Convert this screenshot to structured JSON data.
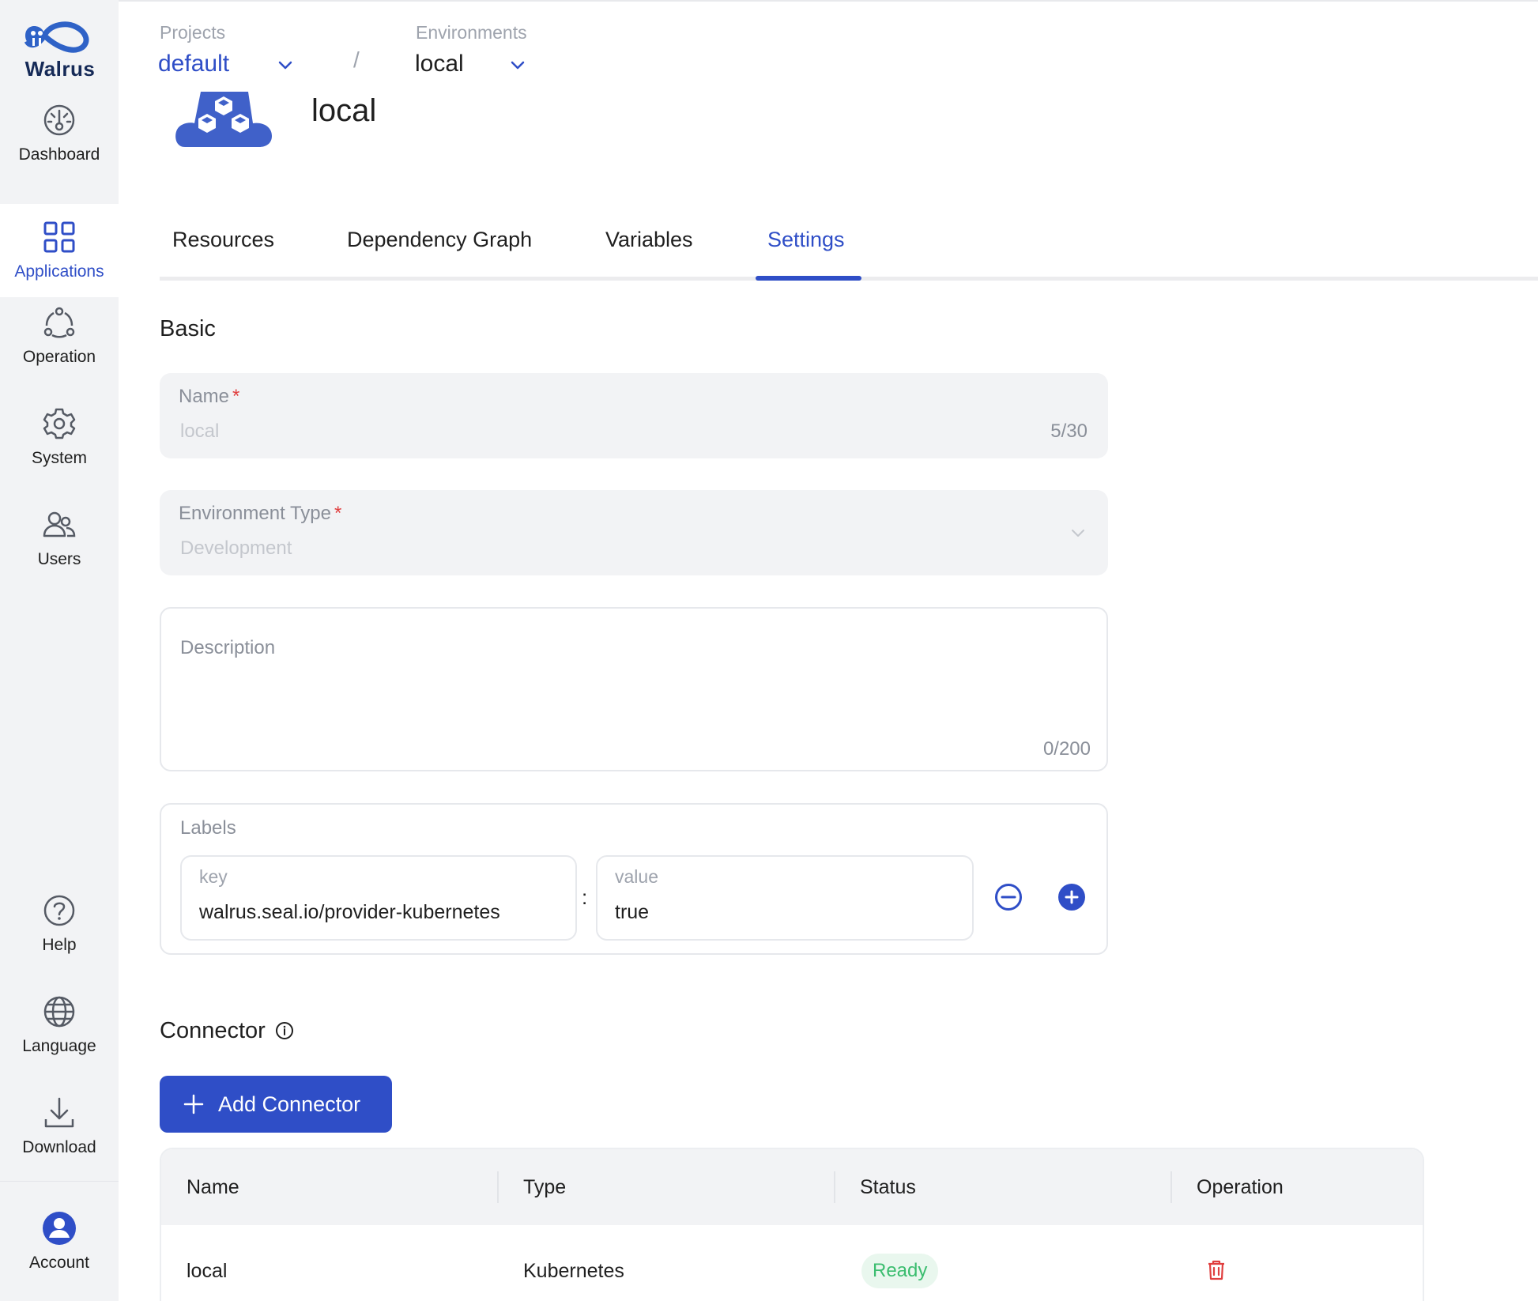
{
  "brand": {
    "name": "Walrus"
  },
  "sidebar": {
    "items": [
      {
        "id": "dashboard",
        "label": "Dashboard",
        "icon": "dashboard-icon",
        "active": false
      },
      {
        "id": "applications",
        "label": "Applications",
        "icon": "applications-icon",
        "active": true
      },
      {
        "id": "operation",
        "label": "Operation",
        "icon": "operation-icon",
        "active": false
      },
      {
        "id": "system",
        "label": "System",
        "icon": "gear-icon",
        "active": false
      },
      {
        "id": "users",
        "label": "Users",
        "icon": "users-icon",
        "active": false
      }
    ],
    "bottom_items": [
      {
        "id": "help",
        "label": "Help",
        "icon": "help-icon"
      },
      {
        "id": "language",
        "label": "Language",
        "icon": "globe-icon"
      },
      {
        "id": "download",
        "label": "Download",
        "icon": "download-icon"
      },
      {
        "id": "account",
        "label": "Account",
        "icon": "account-icon"
      }
    ]
  },
  "breadcrumb": {
    "projects_label": "Projects",
    "project_value": "default",
    "separator": "/",
    "environments_label": "Environments",
    "environment_value": "local"
  },
  "header": {
    "title": "local"
  },
  "tabs": [
    {
      "label": "Resources",
      "active": false
    },
    {
      "label": "Dependency Graph",
      "active": false
    },
    {
      "label": "Variables",
      "active": false
    },
    {
      "label": "Settings",
      "active": true
    }
  ],
  "basic": {
    "title": "Basic",
    "name_field": {
      "label": "Name",
      "value": "local",
      "count": "5/30"
    },
    "env_type_field": {
      "label": "Environment Type",
      "value": "Development"
    },
    "description_field": {
      "label": "Description",
      "count": "0/200"
    },
    "labels": {
      "title": "Labels",
      "key_label": "key",
      "key_value": "walrus.seal.io/provider-kubernetes",
      "separator": ":",
      "value_label": "value",
      "value_value": "true"
    }
  },
  "connector": {
    "title": "Connector",
    "add_button": "Add Connector",
    "columns": [
      "Name",
      "Type",
      "Status",
      "Operation"
    ],
    "rows": [
      {
        "name": "local",
        "type": "Kubernetes",
        "status": "Ready"
      }
    ]
  },
  "colors": {
    "accent": "#2f4ec7",
    "sidebar_bg": "#f2f3f5",
    "required": "#e03e3e",
    "ready_text": "#3bbd6f",
    "ready_bg": "#e9f7ee",
    "danger": "#e03e3e"
  }
}
